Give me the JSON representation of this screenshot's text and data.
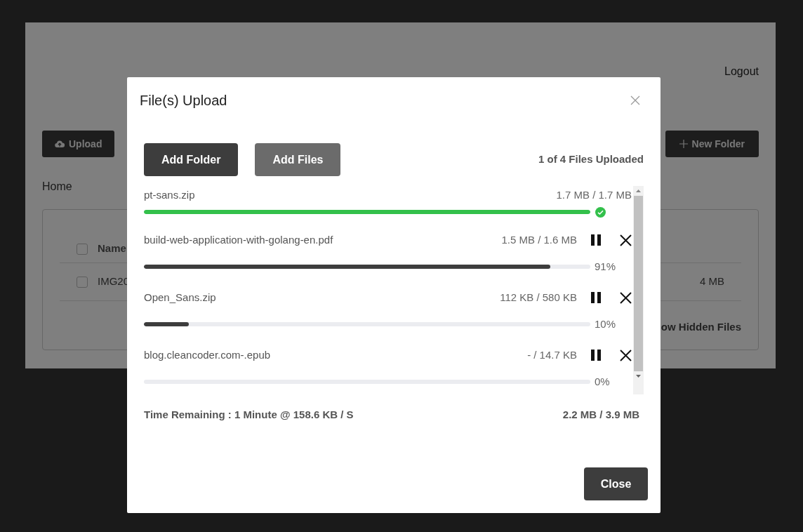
{
  "page": {
    "logout": "Logout",
    "toolbar": [
      {
        "kind": "upload",
        "label": "Upload"
      },
      {
        "kind": "new_folder",
        "label": "New Folder"
      }
    ],
    "breadcrumb": "Home",
    "table": {
      "header": {
        "checked": false,
        "name": "Name"
      },
      "rows": [
        {
          "checked": false,
          "name": "IMG20",
          "size": "4 MB"
        }
      ],
      "footer_link": "ow Hidden Files"
    }
  },
  "dialog": {
    "title": "File(s) Upload",
    "buttons": [
      {
        "label": "Add Folder",
        "kind": "primary"
      },
      {
        "label": "Add Files",
        "kind": "secondary"
      }
    ],
    "summary": "1 of 4 Files Uploaded",
    "uploads": [
      {
        "kind": "done",
        "name": "pt-sans.zip",
        "size": "1.7 MB / 1.7 MB",
        "level": 1
      },
      {
        "kind": "active",
        "name": "build-web-application-with-golang-en.pdf",
        "size": "1.5 MB / 1.6 MB",
        "level": 0.91,
        "percent": "91%"
      },
      {
        "kind": "active",
        "name": "Open_Sans.zip",
        "size": "112 KB / 580 KB",
        "level": 0.1,
        "percent": "10%"
      },
      {
        "kind": "active",
        "name": "blog.cleancoder.com-.epub",
        "size": "- / 14.7 KB",
        "level": 0,
        "percent": "0%"
      }
    ],
    "time_remaining": "Time Remaining : 1 Minute @ 158.6 KB / S",
    "total": "2.2 MB / 3.9 MB",
    "close_button": "Close"
  }
}
